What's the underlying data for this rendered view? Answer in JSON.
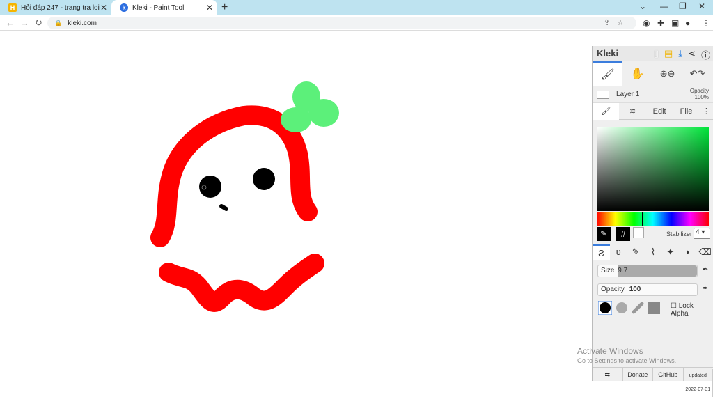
{
  "browser": {
    "tabs": [
      {
        "title": "Hỏi đáp 247 - trang tra loi",
        "active": false
      },
      {
        "title": "Kleki - Paint Tool",
        "active": true
      }
    ],
    "url": "kleki.com"
  },
  "app": {
    "brand": "Kleki",
    "layer_name": "Layer 1",
    "layer_opacity_label": "Opacity",
    "layer_opacity_value": "100%",
    "side_tabs": [
      "Edit",
      "File"
    ],
    "stabilizer_label": "Stabilizer",
    "stabilizer_value": "4",
    "size_label": "Size",
    "size_value": "9.7",
    "size_level": 0.2,
    "opacity_label": "Opacity",
    "opacity_value": "100",
    "lock_alpha_label": "Lock Alpha",
    "footer": {
      "donate": "Donate",
      "github": "GitHub",
      "updated": "updated",
      "date": "2022-07-31"
    },
    "colors": {
      "primary": "#000000",
      "secondary": "#ffffff",
      "stroke_red": "#ff0000",
      "stroke_green": "#5cf07a"
    }
  },
  "watermark": {
    "line1": "Activate Windows",
    "line2": "Go to Settings to activate Windows."
  }
}
